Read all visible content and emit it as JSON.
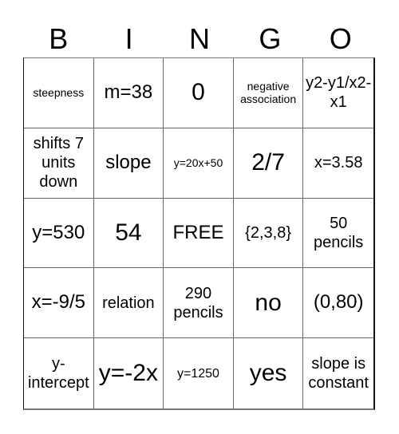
{
  "header": {
    "letters": [
      "B",
      "I",
      "N",
      "G",
      "O"
    ]
  },
  "cells": [
    {
      "text": "steepness",
      "size": "xs"
    },
    {
      "text": "m=38",
      "size": "lg"
    },
    {
      "text": "0",
      "size": "xl"
    },
    {
      "text": "negative association",
      "size": "xs"
    },
    {
      "text": "y2-y1/x2-x1",
      "size": "md"
    },
    {
      "text": "shifts 7 units down",
      "size": "md"
    },
    {
      "text": "slope",
      "size": "lg"
    },
    {
      "text": "y=20x+50",
      "size": "xs"
    },
    {
      "text": "2/7",
      "size": "xl"
    },
    {
      "text": "x=3.58",
      "size": "md"
    },
    {
      "text": "y=530",
      "size": "lg"
    },
    {
      "text": "54",
      "size": "xl"
    },
    {
      "text": "FREE",
      "size": "lg"
    },
    {
      "text": "{2,3,8}",
      "size": "md"
    },
    {
      "text": "50 pencils",
      "size": "md"
    },
    {
      "text": "x=-9/5",
      "size": "lg"
    },
    {
      "text": "relation",
      "size": "md"
    },
    {
      "text": "290 pencils",
      "size": "md"
    },
    {
      "text": "no",
      "size": "xl"
    },
    {
      "text": "(0,80)",
      "size": "lg"
    },
    {
      "text": "y-intercept",
      "size": "md"
    },
    {
      "text": "y=-2x",
      "size": "xl"
    },
    {
      "text": "y=1250",
      "size": "sm"
    },
    {
      "text": "yes",
      "size": "xl"
    },
    {
      "text": "slope is constant",
      "size": "md"
    }
  ]
}
